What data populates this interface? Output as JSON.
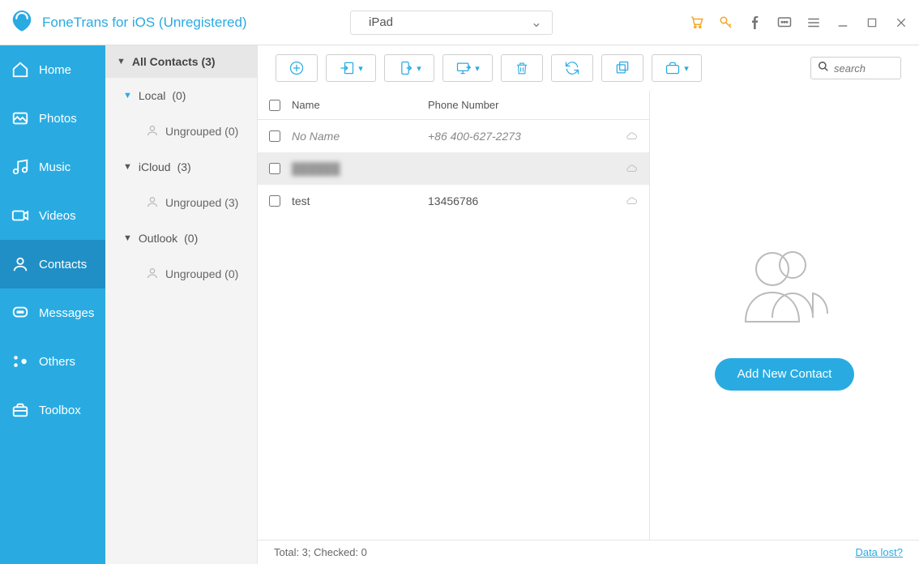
{
  "app_title": "FoneTrans for iOS (Unregistered)",
  "device": {
    "name": "iPad"
  },
  "sidebar": {
    "items": [
      {
        "label": "Home",
        "icon": "home"
      },
      {
        "label": "Photos",
        "icon": "photos"
      },
      {
        "label": "Music",
        "icon": "music"
      },
      {
        "label": "Videos",
        "icon": "videos"
      },
      {
        "label": "Contacts",
        "icon": "contacts",
        "selected": true
      },
      {
        "label": "Messages",
        "icon": "messages"
      },
      {
        "label": "Others",
        "icon": "others"
      },
      {
        "label": "Toolbox",
        "icon": "toolbox"
      }
    ]
  },
  "tree": {
    "header": "All Contacts  (3)",
    "groups": [
      {
        "name": "Local",
        "count_label": "(0)",
        "sub": "Ungrouped  (0)",
        "open": true,
        "blue": true
      },
      {
        "name": "iCloud",
        "count_label": "(3)",
        "sub": "Ungrouped  (3)",
        "open": true
      },
      {
        "name": "Outlook",
        "count_label": "(0)",
        "sub": "Ungrouped  (0)",
        "open": true
      }
    ]
  },
  "search": {
    "placeholder": "search"
  },
  "table": {
    "columns": {
      "name": "Name",
      "phone": "Phone Number"
    },
    "rows": [
      {
        "name": "No Name",
        "phone": "+86 400-627-2273",
        "italic": true
      },
      {
        "name": "██████",
        "phone": "",
        "blurred": true,
        "selected": true
      },
      {
        "name": "test",
        "phone": "13456786"
      }
    ]
  },
  "detail": {
    "add_label": "Add New Contact"
  },
  "footer": {
    "status": "Total: 3; Checked: 0",
    "data_lost": "Data lost?"
  }
}
